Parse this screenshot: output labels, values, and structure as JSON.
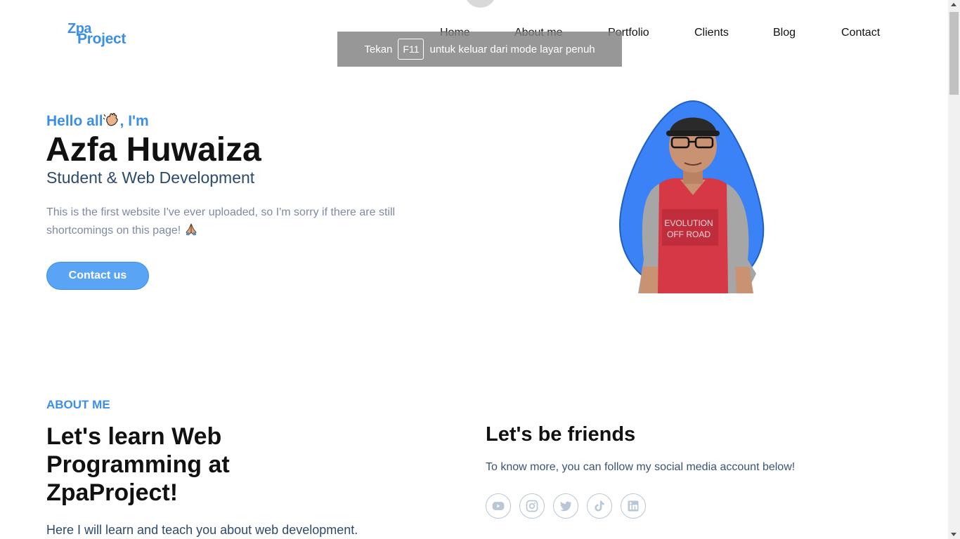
{
  "brand": {
    "logo_top": "Zpa",
    "logo_bottom": "Project"
  },
  "nav": {
    "items": [
      {
        "label": "Home"
      },
      {
        "label": "About me"
      },
      {
        "label": "Portfolio"
      },
      {
        "label": "Clients"
      },
      {
        "label": "Blog"
      },
      {
        "label": "Contact"
      }
    ]
  },
  "fullscreen_notice": {
    "prefix": "Tekan",
    "key": "F11",
    "suffix": "untuk keluar dari mode layar penuh"
  },
  "hero": {
    "greeting_prefix": "Hello all",
    "greeting_suffix": ", I'm",
    "name": "Azfa Huwaiza",
    "role": "Student & Web Development",
    "description": "This is the first website I've ever uploaded, so I'm sorry if there are still shortcomings on this page!",
    "contact_button": "Contact us"
  },
  "about": {
    "label": "ABOUT ME",
    "heading": "Let's learn Web Programming at ZpaProject!",
    "text": "Here I will learn and teach you about web development."
  },
  "friends": {
    "heading": "Let's be friends",
    "text": "To know more, you can follow my social media account below!",
    "socials": [
      "youtube-icon",
      "instagram-icon",
      "twitter-icon",
      "tiktok-icon",
      "linkedin-icon"
    ]
  },
  "colors": {
    "accent": "#3b8fe8",
    "button": "#5aa4f5",
    "photo_blob": "#3b82f6"
  }
}
